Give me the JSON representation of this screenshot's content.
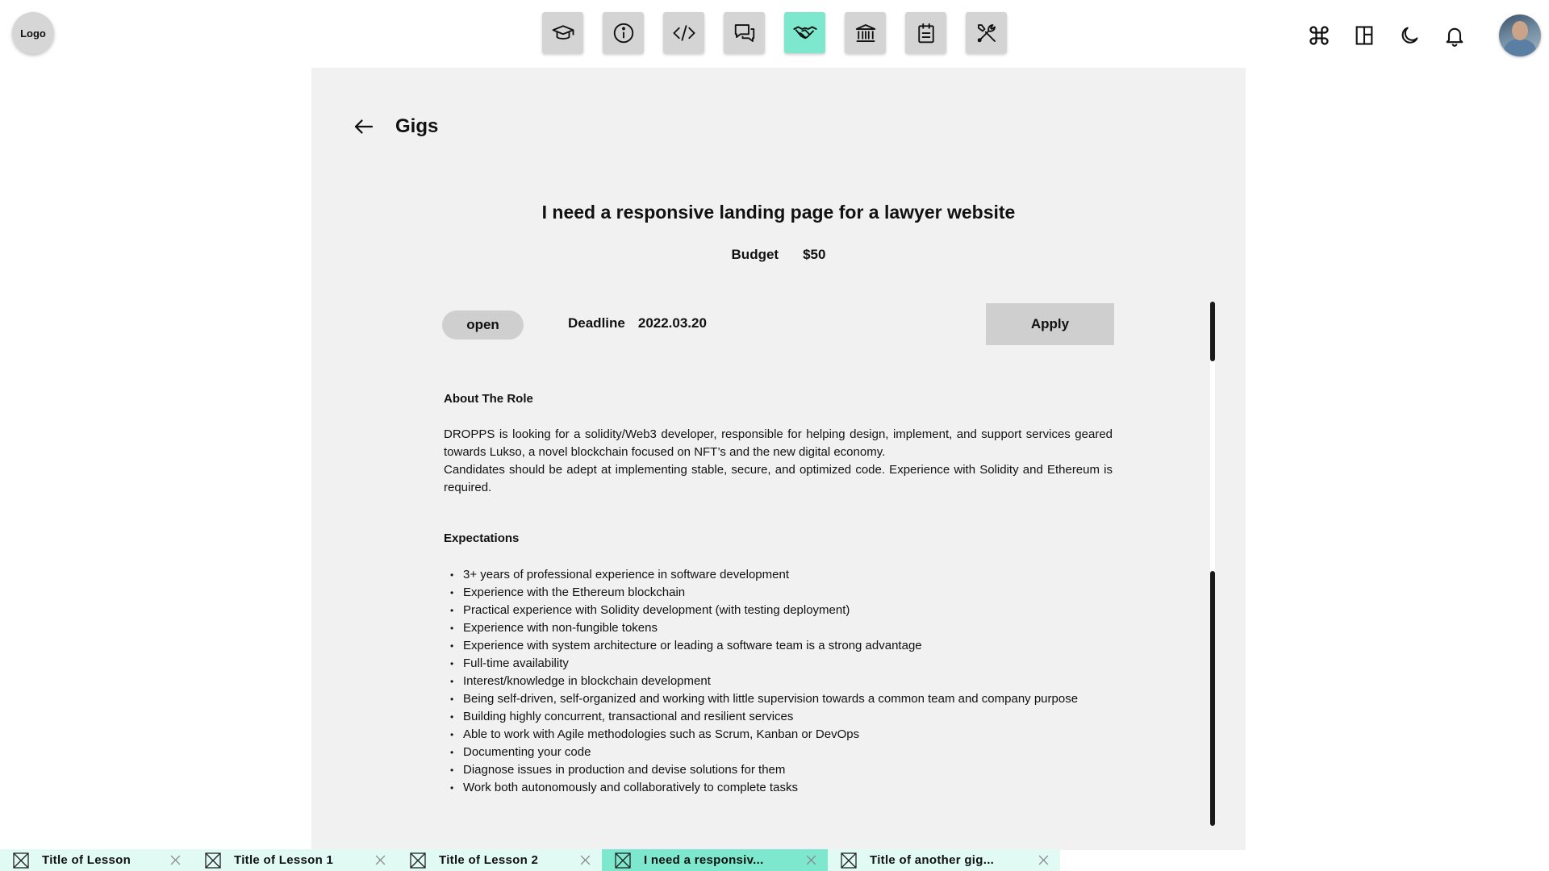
{
  "header": {
    "logo": "Logo",
    "nav": [
      {
        "icon": "graduation-cap-icon",
        "active": false
      },
      {
        "icon": "info-icon",
        "active": false
      },
      {
        "icon": "code-icon",
        "active": false
      },
      {
        "icon": "chat-icon",
        "active": false
      },
      {
        "icon": "handshake-icon",
        "active": true
      },
      {
        "icon": "bank-icon",
        "active": false
      },
      {
        "icon": "notepad-icon",
        "active": false
      },
      {
        "icon": "tools-icon",
        "active": false
      }
    ],
    "right_icons": [
      "command-icon",
      "layout-icon",
      "moon-icon",
      "bell-icon"
    ],
    "avatar": "user-avatar"
  },
  "page": {
    "title": "Gigs",
    "gig_title": "I need a responsive landing page for a lawyer website",
    "budget_label": "Budget",
    "budget_value": "$50",
    "status": "open",
    "deadline_label": "Deadline",
    "deadline_value": "2022.03.20",
    "apply_label": "Apply",
    "about_heading": "About The Role",
    "about_p1": "DROPPS is looking for a solidity/Web3 developer, responsible for helping design, implement, and support services geared towards Lukso, a novel blockchain focused on NFT’s and the new digital economy.",
    "about_p2": "Candidates should be adept at implementing stable, secure, and optimized code. Experience with Solidity and Ethereum is required.",
    "expectations_heading": "Expectations",
    "expectations": [
      "3+ years of professional experience in software development",
      "Experience with the Ethereum blockchain",
      "Practical experience with Solidity development (with testing deployment)",
      "Experience with non-fungible tokens",
      "Experience with system architecture or leading a software team is a strong advantage",
      "Full-time availability",
      "Interest/knowledge in blockchain development",
      "Being self-driven, self-organized and working with little supervision towards a common team and company purpose",
      "Building highly concurrent, transactional and resilient services",
      "Able to work with Agile methodologies such as Scrum, Kanban or DevOps",
      "Documenting your code",
      "Diagnose issues in production and devise solutions for them",
      "Work both autonomously and collaboratively to complete tasks"
    ]
  },
  "tabs": [
    {
      "label": "Title of Lesson",
      "active": false
    },
    {
      "label": "Title of Lesson 1",
      "active": false
    },
    {
      "label": "Title of Lesson 2",
      "active": false
    },
    {
      "label": "I need a responsiv...",
      "active": true
    },
    {
      "label": "Title of another gig...",
      "active": false
    }
  ],
  "colors": {
    "accent": "#7de8cd",
    "tab_bg": "#e1fbf4",
    "panel_bg": "#f1f1f1",
    "button_bg": "#d4d4d4"
  }
}
